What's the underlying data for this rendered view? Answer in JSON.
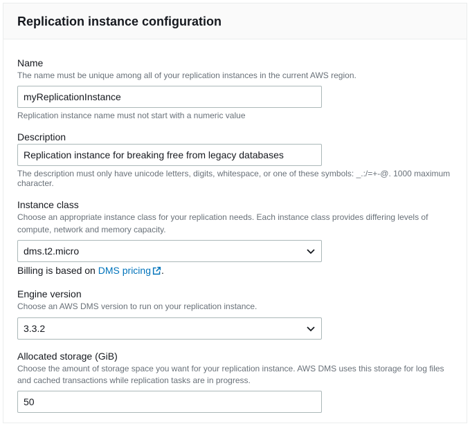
{
  "header": {
    "title": "Replication instance configuration"
  },
  "fields": {
    "name": {
      "label": "Name",
      "hint": "The name must be unique among all of your replication instances in the current AWS region.",
      "value": "myReplicationInstance",
      "below": "Replication instance name must not start with a numeric value"
    },
    "description": {
      "label": "Description",
      "value": "Replication instance for breaking free from legacy databases",
      "below": "The description must only have unicode letters, digits, whitespace, or one of these symbols: _.:/=+-@. 1000 maximum character."
    },
    "instanceClass": {
      "label": "Instance class",
      "hint": "Choose an appropriate instance class for your replication needs. Each instance class provides differing levels of compute, network and memory capacity.",
      "value": "dms.t2.micro",
      "billingPrefix": "Billing is based on ",
      "billingLink": "DMS pricing",
      "billingSuffix": "."
    },
    "engineVersion": {
      "label": "Engine version",
      "hint": "Choose an AWS DMS version to run on your replication instance.",
      "value": "3.3.2"
    },
    "allocatedStorage": {
      "label": "Allocated storage (GiB)",
      "hint": "Choose the amount of storage space you want for your replication instance. AWS DMS uses this storage for log files and cached transactions while replication tasks are in progress.",
      "value": "50"
    }
  }
}
